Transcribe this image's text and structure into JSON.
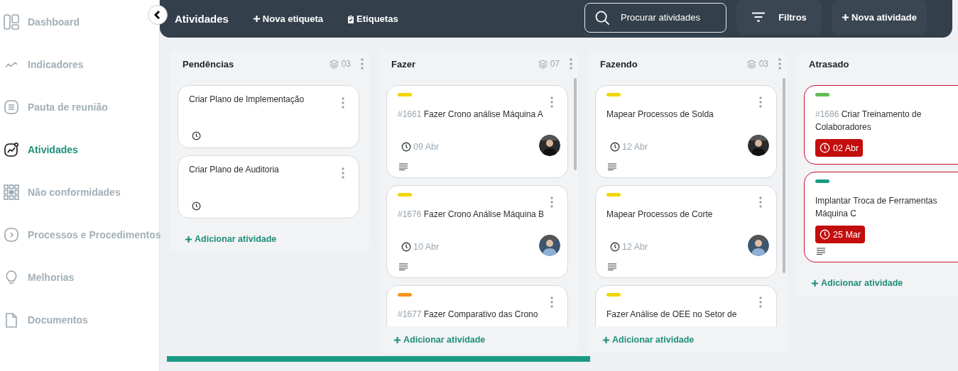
{
  "sidebar": {
    "items": [
      {
        "label": "Dashboard",
        "selected": false
      },
      {
        "label": "Indicadores",
        "selected": false
      },
      {
        "label": "Pauta de reunião",
        "selected": false
      },
      {
        "label": "Atividades",
        "selected": true
      },
      {
        "label": "Não conformidades",
        "selected": false
      },
      {
        "label": "Processos e Procedimentos",
        "selected": false
      },
      {
        "label": "Melhorias",
        "selected": false
      },
      {
        "label": "Documentos",
        "selected": false
      }
    ]
  },
  "header": {
    "title": "Atividades",
    "new_tag": "Nova etiqueta",
    "tags": "Etiquetas",
    "search": {
      "placeholder": "Procurar atividades"
    },
    "filters": "Filtros",
    "new_activity": "Nova atividade"
  },
  "columns": [
    {
      "title": "Pendências",
      "count": "03",
      "scrollable": false,
      "add_label": "Adicionar atividade",
      "cards": [
        {
          "title": "Criar Plano de Implementação",
          "due": true,
          "overdue": false,
          "assignee": false,
          "notes": false
        },
        {
          "title": "Criar Plano de Auditoria",
          "due": true,
          "overdue": false,
          "assignee": false,
          "notes": false
        }
      ]
    },
    {
      "title": "Fazer",
      "count": "07",
      "scrollable": true,
      "add_label": "Adicionar atividade",
      "cards": [
        {
          "color": "#f2d600",
          "number": "#1661",
          "title": "Fazer Crono análise Máquina A",
          "due": true,
          "date": "09 Abr",
          "overdue": false,
          "assignee": true,
          "notes": true
        },
        {
          "color": "#f2d600",
          "number": "#1676",
          "title": "Fazer Crono Análise Máquina B",
          "due": true,
          "date": "10 Abr",
          "overdue": false,
          "assignee": true,
          "notes": true
        },
        {
          "color": "#f7941d",
          "number": "#1677",
          "title": "Fazer Comparativo das Crono",
          "due": false,
          "overdue": false
        }
      ]
    },
    {
      "title": "Fazendo",
      "count": "03",
      "scrollable": true,
      "add_label": "Adicionar atividade",
      "cards": [
        {
          "color": "#f2d600",
          "title": "Mapear Processos de Solda",
          "due": true,
          "date": "12 Abr",
          "overdue": false,
          "assignee": true,
          "notes": true
        },
        {
          "color": "#f2d600",
          "title": "Mapear Processos de Corte",
          "due": true,
          "date": "12 Abr",
          "overdue": false,
          "assignee": true,
          "notes": true
        },
        {
          "color": "#f2d600",
          "title": "Fazer Análise de OEE no Setor de",
          "due": false,
          "overdue": false
        }
      ]
    },
    {
      "title": "Atrasado",
      "scrollable": false,
      "add_label": "Adicionar atividade",
      "cards": [
        {
          "color": "#61bd4f",
          "number": "#1686",
          "title": "Criar Treinamento de Colaboradores",
          "due": true,
          "date": "02 Abr",
          "overdue": true,
          "assignee": false,
          "notes": false
        },
        {
          "color": "#1a9a85",
          "title": "Implantar Troca de Ferramentas Máquina C",
          "due": true,
          "date": "25 Mar",
          "overdue": true,
          "assignee": false,
          "notes": true
        }
      ]
    }
  ]
}
